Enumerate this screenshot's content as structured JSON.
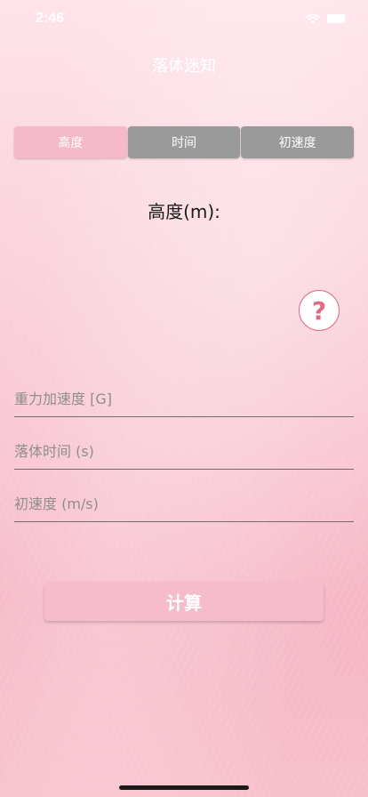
{
  "status_bar": {
    "time": "2:46",
    "wifi_icon": "wifi-icon",
    "battery_icon": "battery-icon"
  },
  "nav": {
    "title": "落体迷知"
  },
  "segments": [
    {
      "label": "高度",
      "selected": true
    },
    {
      "label": "时间",
      "selected": false
    },
    {
      "label": "初速度",
      "selected": false
    }
  ],
  "result": {
    "label": "高度(m):"
  },
  "help": {
    "icon": "question-icon",
    "glyph": "?"
  },
  "inputs": [
    {
      "placeholder": "重力加速度 [G]",
      "value": ""
    },
    {
      "placeholder": "落体时间 (s)",
      "value": ""
    },
    {
      "placeholder": "初速度 (m/s)",
      "value": ""
    }
  ],
  "calculate": {
    "label": "计算"
  },
  "colors": {
    "accent_pink": "#f6b9ca",
    "segment_inactive": "#9a9a9a",
    "help_red": "#e06b83"
  }
}
